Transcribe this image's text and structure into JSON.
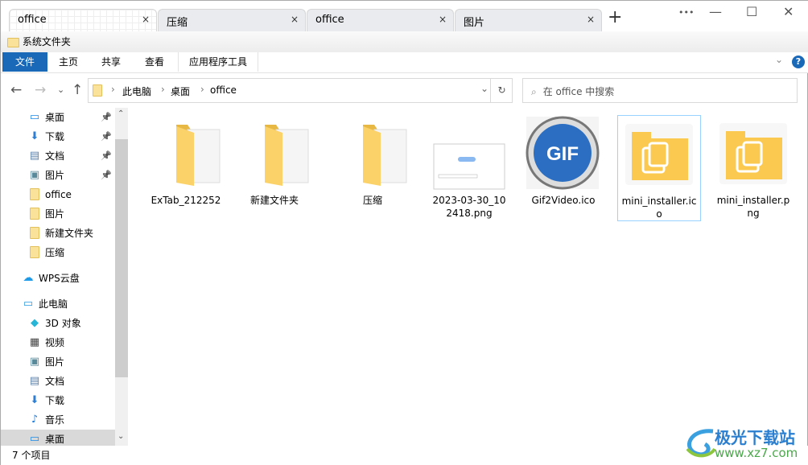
{
  "tabs": [
    {
      "label": "office",
      "active": true
    },
    {
      "label": "压缩"
    },
    {
      "label": "office"
    },
    {
      "label": "图片"
    }
  ],
  "window": {
    "more": "•••",
    "minimize": "—",
    "maximize": "☐",
    "close": "✕",
    "new_tab": "+",
    "tab_close": "×"
  },
  "titlebar": {
    "title": "系统文件夹"
  },
  "ribbon": {
    "tabs": [
      "文件",
      "主页",
      "共享",
      "查看",
      "应用程序工具"
    ],
    "accent": "#1a68b8",
    "expand": "⌄",
    "help": "?"
  },
  "address": {
    "crumbs": [
      "此电脑",
      "桌面",
      "office"
    ],
    "sep": "›",
    "dropdown": "⌄",
    "refresh": "↻"
  },
  "search": {
    "placeholder": "在 office 中搜索",
    "icon": "⌕"
  },
  "nav": {
    "back": "←",
    "forward": "→",
    "recent": "⌄",
    "up": "↑"
  },
  "sidebar": {
    "items": [
      {
        "label": "桌面",
        "icon": "desktop-icon",
        "pinned": true
      },
      {
        "label": "下载",
        "icon": "download-icon",
        "pinned": true
      },
      {
        "label": "文档",
        "icon": "document-icon",
        "pinned": true
      },
      {
        "label": "图片",
        "icon": "pictures-icon",
        "pinned": true
      },
      {
        "label": "office",
        "icon": "folder-icon"
      },
      {
        "label": "图片",
        "icon": "folder-icon"
      },
      {
        "label": "新建文件夹",
        "icon": "folder-icon"
      },
      {
        "label": "压缩",
        "icon": "folder-icon"
      },
      {
        "label": "WPS云盘",
        "icon": "cloud-icon"
      },
      {
        "label": "此电脑",
        "icon": "computer-icon"
      },
      {
        "label": "3D 对象",
        "icon": "3d-icon"
      },
      {
        "label": "视频",
        "icon": "video-icon"
      },
      {
        "label": "图片",
        "icon": "pictures-icon"
      },
      {
        "label": "文档",
        "icon": "document-icon"
      },
      {
        "label": "下载",
        "icon": "download-icon"
      },
      {
        "label": "音乐",
        "icon": "music-icon"
      },
      {
        "label": "桌面",
        "icon": "desktop-icon",
        "selected": true
      }
    ]
  },
  "files": [
    {
      "name": "ExTab_212252",
      "type": "folder"
    },
    {
      "name": "新建文件夹",
      "type": "folder"
    },
    {
      "name": "压缩",
      "type": "folder"
    },
    {
      "name": "2023-03-30_102418.png",
      "type": "image"
    },
    {
      "name": "Gif2Video.ico",
      "type": "gif-icon",
      "badge": "GIF"
    },
    {
      "name": "mini_installer.ico",
      "type": "installer",
      "selected": true
    },
    {
      "name": "mini_installer.png",
      "type": "installer"
    }
  ],
  "status": {
    "count": "7 个项目"
  },
  "watermark": {
    "text": "极光下载站",
    "url": "www.xz7.com"
  }
}
